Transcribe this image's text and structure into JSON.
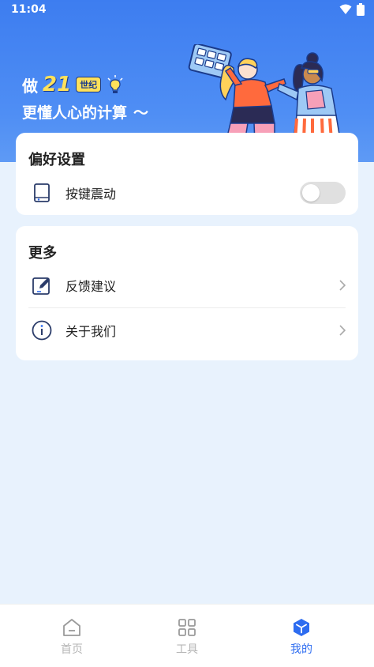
{
  "status_bar": {
    "time": "11:04"
  },
  "banner": {
    "slogan_prefix": "做",
    "slogan_number": "21",
    "slogan_badge": "世纪",
    "slogan_line2": "更懂人心的计算",
    "slogan_tilde": "〜"
  },
  "preferences": {
    "title": "偏好设置",
    "key_vibration": {
      "label": "按键震动",
      "enabled": false,
      "icon": "tablet-icon"
    }
  },
  "more": {
    "title": "更多",
    "items": [
      {
        "label": "反馈建议",
        "icon": "edit-icon"
      },
      {
        "label": "关于我们",
        "icon": "info-icon"
      }
    ]
  },
  "bottom_nav": {
    "items": [
      {
        "label": "首页",
        "icon": "home-icon",
        "active": false
      },
      {
        "label": "工具",
        "icon": "grid-icon",
        "active": false
      },
      {
        "label": "我的",
        "icon": "cube-icon",
        "active": true
      }
    ]
  },
  "colors": {
    "accent": "#2d6cf0",
    "hero_blue": "#3d7df0",
    "page_bg": "#e8f2fd",
    "inactive": "#b5b5b5"
  }
}
